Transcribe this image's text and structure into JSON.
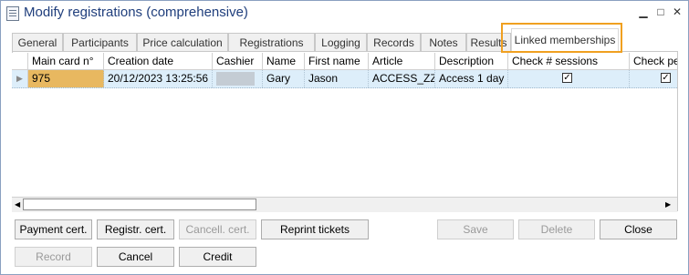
{
  "window": {
    "title": "Modify registrations (comprehensive)",
    "minimize_glyph": "▁",
    "maximize_glyph": "□",
    "close_glyph": "✕"
  },
  "tabs": [
    {
      "label": "General"
    },
    {
      "label": "Participants"
    },
    {
      "label": "Price calculation"
    },
    {
      "label": "Registrations"
    },
    {
      "label": "Logging"
    },
    {
      "label": "Records"
    },
    {
      "label": "Notes"
    },
    {
      "label": "Results"
    },
    {
      "label": "Linked memberships",
      "active": true
    }
  ],
  "grid": {
    "columns": [
      "Main card n°",
      "Creation date",
      "Cashier",
      "Name",
      "First name",
      "Article",
      "Description",
      "Check # sessions",
      "Check per"
    ],
    "rows": [
      {
        "main_card": "975",
        "creation_date": "20/12/2023 13:25:56",
        "cashier": "",
        "name": "Gary",
        "first_name": "Jason",
        "article": "ACCESS_ZZ",
        "description": "Access 1 day",
        "check_sessions": true,
        "check_per": true
      }
    ],
    "row_indicator": "▶"
  },
  "scrollbar": {
    "left_arrow": "◀",
    "right_arrow": "▶"
  },
  "buttons_row1": [
    {
      "label": "Payment cert.",
      "enabled": true
    },
    {
      "label": "Registr. cert.",
      "enabled": true
    },
    {
      "label": "Cancell. cert.",
      "enabled": false
    },
    {
      "label": "Reprint tickets",
      "enabled": true
    },
    {
      "label": "Save",
      "enabled": false
    },
    {
      "label": "Delete",
      "enabled": false
    },
    {
      "label": "Close",
      "enabled": true
    }
  ],
  "buttons_row2": [
    {
      "label": "Record",
      "enabled": false
    },
    {
      "label": "Cancel",
      "enabled": true
    },
    {
      "label": "Credit",
      "enabled": true
    }
  ],
  "colors": {
    "title": "#1f3e7c",
    "selected_row": "#ddeefa",
    "current_cell": "#e8b860",
    "tab_highlight": "#f0a020"
  }
}
